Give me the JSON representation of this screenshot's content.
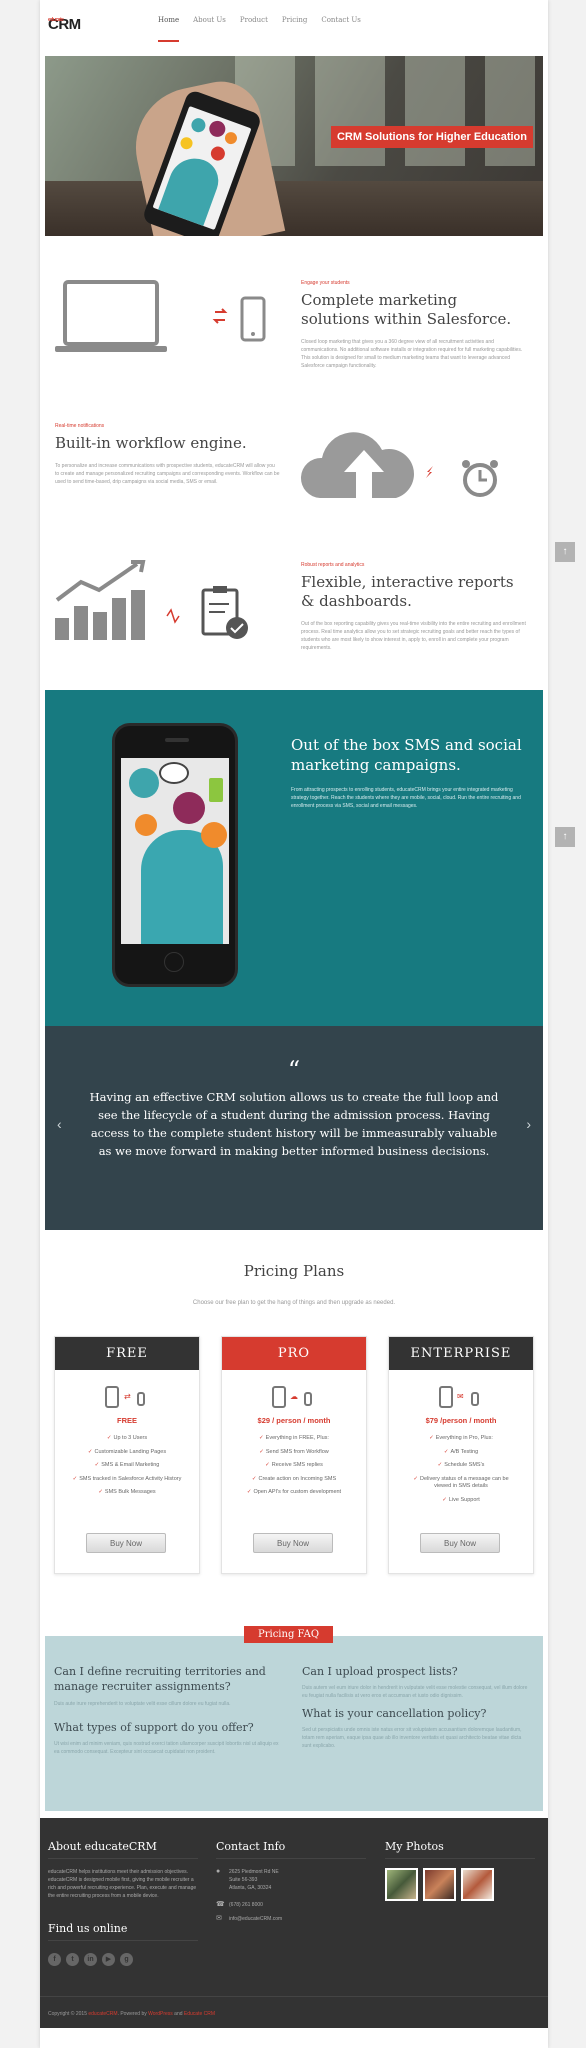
{
  "logo": {
    "part1": "educate",
    "part2": "CRM"
  },
  "nav": {
    "items": [
      "Home",
      "About Us",
      "Product",
      "Pricing",
      "Contact Us"
    ]
  },
  "hero": {
    "banner": "CRM Solutions for Higher Education"
  },
  "features": [
    {
      "kicker": "Engage your students",
      "title": "Complete marketing solutions within Salesforce.",
      "text": "Closed loop marketing that gives you a 360 degree view of all recruitment activities and communications. No additional software installs or integration required for full marketing capabilities. This solution is designed for small to medium marketing teams that want to leverage advanced Salesforce campaign functionality."
    },
    {
      "kicker": "Real-time notifications",
      "title": "Built-in workflow engine.",
      "text": "To personalize and increase communications with prospective students, educateCRM will allow you to create and manage personalized recruiting campaigns and corresponding events. Workflow can be used to send time-based, drip campaigns via social media, SMS or email."
    },
    {
      "kicker": "Robust reports and analytics",
      "title": "Flexible, interactive reports & dashboards.",
      "text": "Out of the box reporting capability gives you real-time visibility into the entire recruiting and enrollment process. Real time analytics allow you to set strategic recruiting goals and better reach the types of students who are most likely to show interest in, apply to, enroll in and complete your program requirements."
    }
  ],
  "sms": {
    "title": "Out of the box SMS and social marketing campaigns.",
    "text": "From attracting prospects to enrolling students, educateCRM brings your entire integrated marketing strategy together. Reach the students where they are mobile, social, cloud. Run the entire recruiting and enrollment process via SMS, social and email messages."
  },
  "quote": {
    "mark": "“",
    "text": "Having an effective CRM solution allows us to create the full loop and see the lifecycle of a student during the admission process. Having access to the complete student history will be immeasurably valuable as we move forward in making better informed business decisions.",
    "prev": "‹",
    "next": "›"
  },
  "pricing": {
    "title": "Pricing Plans",
    "subtitle": "Choose our free plan to get the hang of things and then upgrade as needed.",
    "plans": [
      {
        "name": "FREE",
        "price": "FREE",
        "features": [
          "Up to 3 Users",
          "Customizable Landing Pages",
          "SMS & Email Marketing",
          "SMS tracked in Salesforce Activity History",
          "SMS Bulk Messages"
        ],
        "button": "Buy Now"
      },
      {
        "name": "PRO",
        "price": "$29 / person / month",
        "features": [
          "Everything in FREE, Plus:",
          "Send SMS from Workflow",
          "Receive SMS replies",
          "Create action on Incoming SMS",
          "Open API's for custom development"
        ],
        "button": "Buy Now"
      },
      {
        "name": "ENTERPRISE",
        "price": "$79 /person / month",
        "features": [
          "Everything in Pro, Plus:",
          "A/B Testing",
          "Schedule SMS's",
          "Delivery status of a message can be viewed in SMS details",
          "Live Support"
        ],
        "button": "Buy Now"
      }
    ]
  },
  "faq": {
    "badge": "Pricing FAQ",
    "items": [
      {
        "q": "Can I define recruiting territories and manage recruiter assignments?",
        "a": "Duis aute irure reprehenderit to voluptate velit esse cillum dolore eu fugiat nulla."
      },
      {
        "q": "What types of support do you offer?",
        "a": "Ut wisi enim ad minim veniam, quis nostrud exerci tation ullamcorper suscipit lobortis nisl ut aliquip ex ea commodo consequat. Excepteur sint occaecat cupidatat non proident."
      },
      {
        "q": "Can I upload prospect lists?",
        "a": "Duis autem vel eum iriure dolor in hendrerit in vulputate velit esse molestie consequat, vel illum dolore eu feugiat nulla facilisis at vero eros et accumsan et iusto odio dignissim."
      },
      {
        "q": "What is your cancellation policy?",
        "a": "Sed ut perspiciatis unde omnis iste natus error sit voluptatem accusantium doloremque laudantium, totam rem aperiam, eaque ipsa quae ab illo inventore veritatis et quasi architecto beatae vitae dicta sunt explicabo."
      }
    ]
  },
  "footer": {
    "about_title": "About educateCRM",
    "about_text": "educateCRM helps institutions meet their admission objectives. educateCRM is designed mobile first, giving the mobile recruiter a rich and powerful recruiting experience. Plan, execute and manage the entire recruiting process from a mobile device.",
    "find_title": "Find us online",
    "contact_title": "Contact Info",
    "address": [
      "2625 Piedmont Rd NE",
      "Suite 56-393",
      "Atlanta, GA, 30324"
    ],
    "phone": "(678) 261 8000",
    "email": "info@educateCRM.com",
    "photos_title": "My Photos",
    "copyright": "Copyright © 2015",
    "brand": "educateCRM",
    "powered": ". Powered by",
    "wp": "WordPress",
    "and": "and",
    "theme": "Educate CRM"
  },
  "totop_icon": "↑",
  "colors": {
    "accent": "#d63b2f",
    "teal": "#177a80",
    "dark": "#33444c",
    "footer": "#333333",
    "faq_bg": "#bdd6d9"
  }
}
